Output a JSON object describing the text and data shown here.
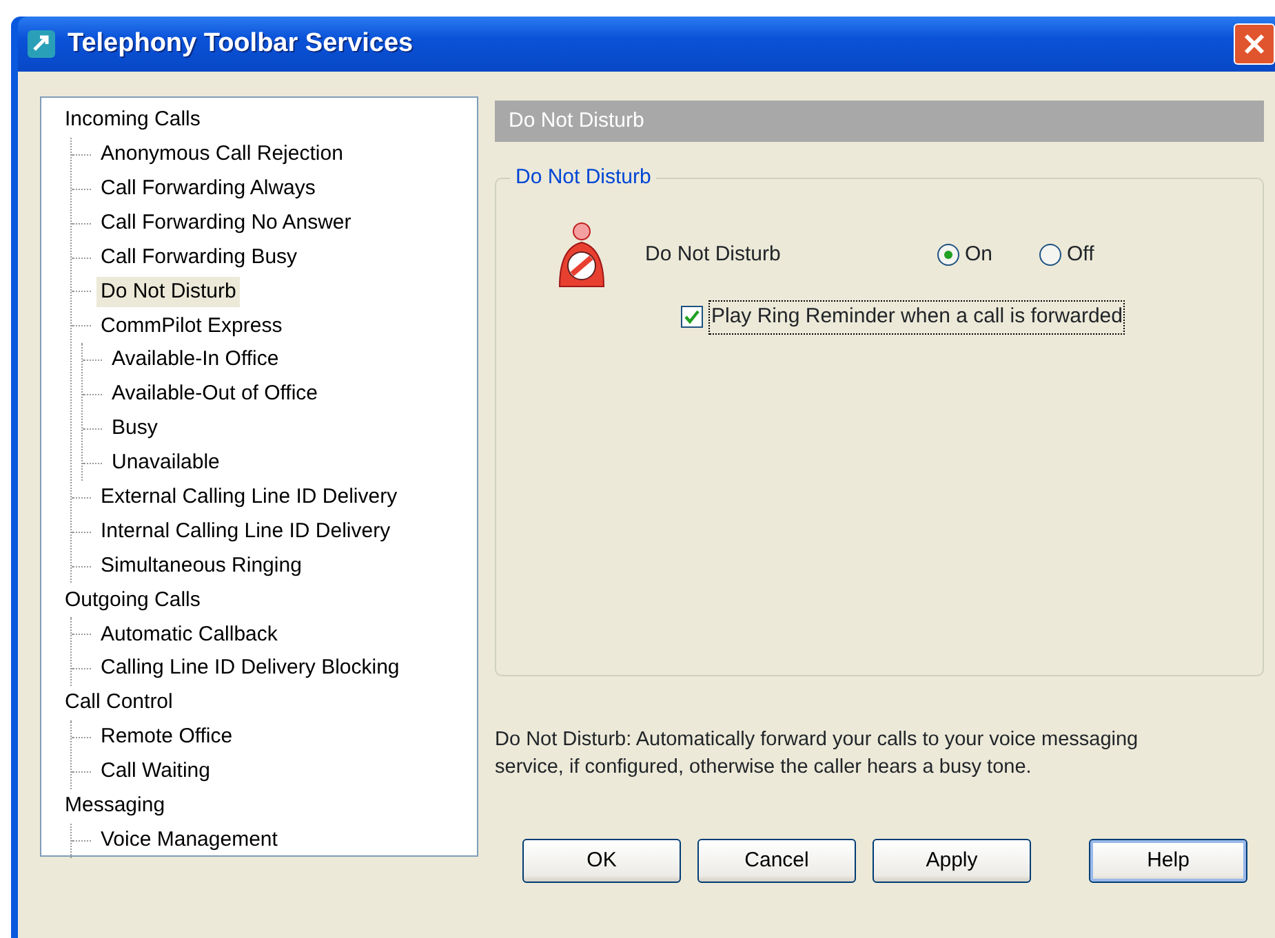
{
  "window": {
    "title": "Telephony Toolbar Services"
  },
  "tree": [
    {
      "label": "Incoming Calls",
      "selected": false,
      "children": [
        {
          "label": "Anonymous Call Rejection",
          "selected": false
        },
        {
          "label": "Call Forwarding Always",
          "selected": false
        },
        {
          "label": "Call Forwarding No Answer",
          "selected": false
        },
        {
          "label": "Call Forwarding Busy",
          "selected": false
        },
        {
          "label": "Do Not Disturb",
          "selected": true
        },
        {
          "label": "CommPilot Express",
          "selected": false,
          "children": [
            {
              "label": "Available-In Office",
              "selected": false
            },
            {
              "label": "Available-Out of Office",
              "selected": false
            },
            {
              "label": "Busy",
              "selected": false
            },
            {
              "label": "Unavailable",
              "selected": false
            }
          ]
        },
        {
          "label": "External Calling Line ID Delivery",
          "selected": false
        },
        {
          "label": "Internal Calling Line ID Delivery",
          "selected": false
        },
        {
          "label": "Simultaneous Ringing",
          "selected": false
        }
      ]
    },
    {
      "label": "Outgoing Calls",
      "selected": false,
      "children": [
        {
          "label": "Automatic Callback",
          "selected": false
        },
        {
          "label": "Calling Line ID Delivery Blocking",
          "selected": false
        }
      ]
    },
    {
      "label": "Call Control",
      "selected": false,
      "children": [
        {
          "label": "Remote Office",
          "selected": false
        },
        {
          "label": "Call Waiting",
          "selected": false
        }
      ]
    },
    {
      "label": "Messaging",
      "selected": false,
      "children": [
        {
          "label": "Voice Management",
          "selected": false
        }
      ]
    }
  ],
  "panel": {
    "header": "Do Not Disturb",
    "group_title": "Do Not Disturb",
    "setting_label": "Do Not Disturb",
    "options": [
      {
        "label": "On",
        "selected": true
      },
      {
        "label": "Off",
        "selected": false
      }
    ],
    "checkbox": {
      "label": "Play Ring Reminder when a call is forwarded",
      "checked": true
    },
    "description": "Do Not Disturb: Automatically forward your calls to your voice messaging service, if configured, otherwise the caller hears a busy tone."
  },
  "buttons": [
    {
      "label": "OK",
      "focused": false
    },
    {
      "label": "Cancel",
      "focused": false
    },
    {
      "label": "Apply",
      "focused": false
    },
    {
      "label": "Help",
      "focused": true
    }
  ]
}
